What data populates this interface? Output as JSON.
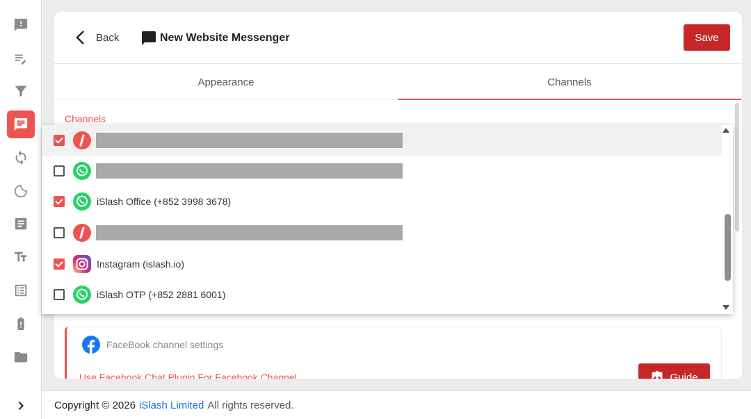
{
  "sidebar": {
    "items": [
      {
        "name": "sidebar-item-feedback",
        "icon": "feedback-icon"
      },
      {
        "name": "sidebar-item-notes",
        "icon": "edit-list-icon"
      },
      {
        "name": "sidebar-item-filter",
        "icon": "filter-icon"
      },
      {
        "name": "sidebar-item-messenger",
        "icon": "chat-icon",
        "active": true
      },
      {
        "name": "sidebar-item-sync",
        "icon": "sync-icon"
      },
      {
        "name": "sidebar-item-sticker",
        "icon": "sticker-icon"
      },
      {
        "name": "sidebar-item-article",
        "icon": "article-icon"
      },
      {
        "name": "sidebar-item-text",
        "icon": "text-format-icon"
      },
      {
        "name": "sidebar-item-list",
        "icon": "list-alt-icon"
      },
      {
        "name": "sidebar-item-battery",
        "icon": "battery-alert-icon"
      },
      {
        "name": "sidebar-item-folder",
        "icon": "folder-icon"
      }
    ],
    "expand_icon": "chevron-right-icon"
  },
  "header": {
    "back_label": "Back",
    "title": "New Website Messenger",
    "save_label": "Save"
  },
  "tabs": [
    {
      "label": "Appearance",
      "active": false
    },
    {
      "label": "Channels",
      "active": true
    }
  ],
  "channels_label": "Channels",
  "channel_list": [
    {
      "checked": true,
      "type": "islash",
      "name": "",
      "redacted": true,
      "highlighted": true
    },
    {
      "checked": false,
      "type": "whatsapp",
      "name": "",
      "redacted": true
    },
    {
      "checked": true,
      "type": "whatsapp",
      "name": "iSlash Office (+852 3998 3678)"
    },
    {
      "checked": false,
      "type": "islash",
      "name": "",
      "redacted": true
    },
    {
      "checked": true,
      "type": "instagram",
      "name": "Instagram (islash.io)"
    },
    {
      "checked": false,
      "type": "whatsapp",
      "name": "iSlash OTP (+852 2881 6001)"
    }
  ],
  "facebook_settings": {
    "title": "FaceBook channel settings",
    "link_text": "Use Facebook Chat Plugin For Facebook Channel",
    "guide_label": "Guide"
  },
  "footer": {
    "copyright": "Copyright © 2026",
    "company": "iSlash Limited",
    "rights": "All rights reserved."
  },
  "colors": {
    "accent": "#ef5350",
    "save_button": "#c62828",
    "link_blue": "#1976d2",
    "whatsapp": "#25d366",
    "facebook": "#1877f2"
  }
}
